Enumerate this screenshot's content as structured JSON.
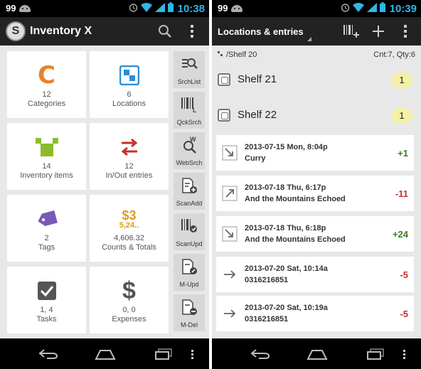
{
  "left": {
    "status": {
      "battery_pct": "99",
      "time": "10:38"
    },
    "app_title": "Inventory X",
    "tiles": [
      {
        "count": "12",
        "label": "Categories",
        "icon": "categories-icon",
        "color": "#e8822a"
      },
      {
        "count": "6",
        "label": "Locations",
        "icon": "locations-icon",
        "color": "#2a8fd4"
      },
      {
        "count": "14",
        "label": "Inventory items",
        "icon": "inventory-icon",
        "color": "#8bbd2a"
      },
      {
        "count": "12",
        "label": "In/Out entries",
        "icon": "inout-icon",
        "color": "#c9302c"
      },
      {
        "count": "2",
        "label": "Tags",
        "icon": "tag-icon",
        "color": "#7a5ab8"
      },
      {
        "count": "4,606.32",
        "label": "Counts & Totals",
        "icon": "totals-icon",
        "icon_text_big": "$3",
        "icon_text_small": "5,24..",
        "color": "#d6a11a"
      },
      {
        "count": "1, 4",
        "label": "Tasks",
        "icon": "tasks-icon",
        "color": "#555555"
      },
      {
        "count": "0, 0",
        "label": "Expenses",
        "icon": "expenses-icon",
        "icon_text": "$",
        "color": "#555555"
      }
    ],
    "side_buttons": [
      {
        "label": "SrchList",
        "icon": "search-list-icon"
      },
      {
        "label": "QckSrch",
        "icon": "quick-search-barcode-icon",
        "icon_text": "L"
      },
      {
        "label": "WebSrch",
        "icon": "web-search-icon",
        "icon_text": "W"
      },
      {
        "label": "ScanAdd",
        "icon": "scan-add-icon"
      },
      {
        "label": "ScanUpd",
        "icon": "scan-update-icon"
      },
      {
        "label": "M-Upd",
        "icon": "manual-update-icon"
      },
      {
        "label": "M-Del",
        "icon": "manual-delete-icon"
      }
    ]
  },
  "right": {
    "status": {
      "battery_pct": "99",
      "time": "10:39"
    },
    "title": "Locations & entries",
    "path": "/Shelf 20",
    "stats": "Cnt:7, Qty:6",
    "shelves": [
      {
        "name": "Shelf 21",
        "qty": "1"
      },
      {
        "name": "Shelf 22",
        "qty": "1"
      }
    ],
    "entries": [
      {
        "date": "2013-07-15 Mon,  8:04p",
        "name": "Curry",
        "qty": "+1",
        "direction": "in"
      },
      {
        "date": "2013-07-18 Thu,  6:17p",
        "name": "And the Mountains Echoed",
        "qty": "-11",
        "direction": "out"
      },
      {
        "date": "2013-07-18 Thu,  6:18p",
        "name": "And the Mountains Echoed",
        "qty": "+24",
        "direction": "in"
      },
      {
        "date": "2013-07-20 Sat,  10:14a",
        "name": "0316216851",
        "qty": "-5",
        "direction": "move"
      },
      {
        "date": "2013-07-20 Sat,  10:19a",
        "name": "0316216851",
        "qty": "-5",
        "direction": "move"
      }
    ]
  },
  "colors": {
    "accent": "#33b5e5",
    "positive": "#3a7a1f",
    "negative": "#c9302c",
    "badge": "#f5f0a8"
  }
}
